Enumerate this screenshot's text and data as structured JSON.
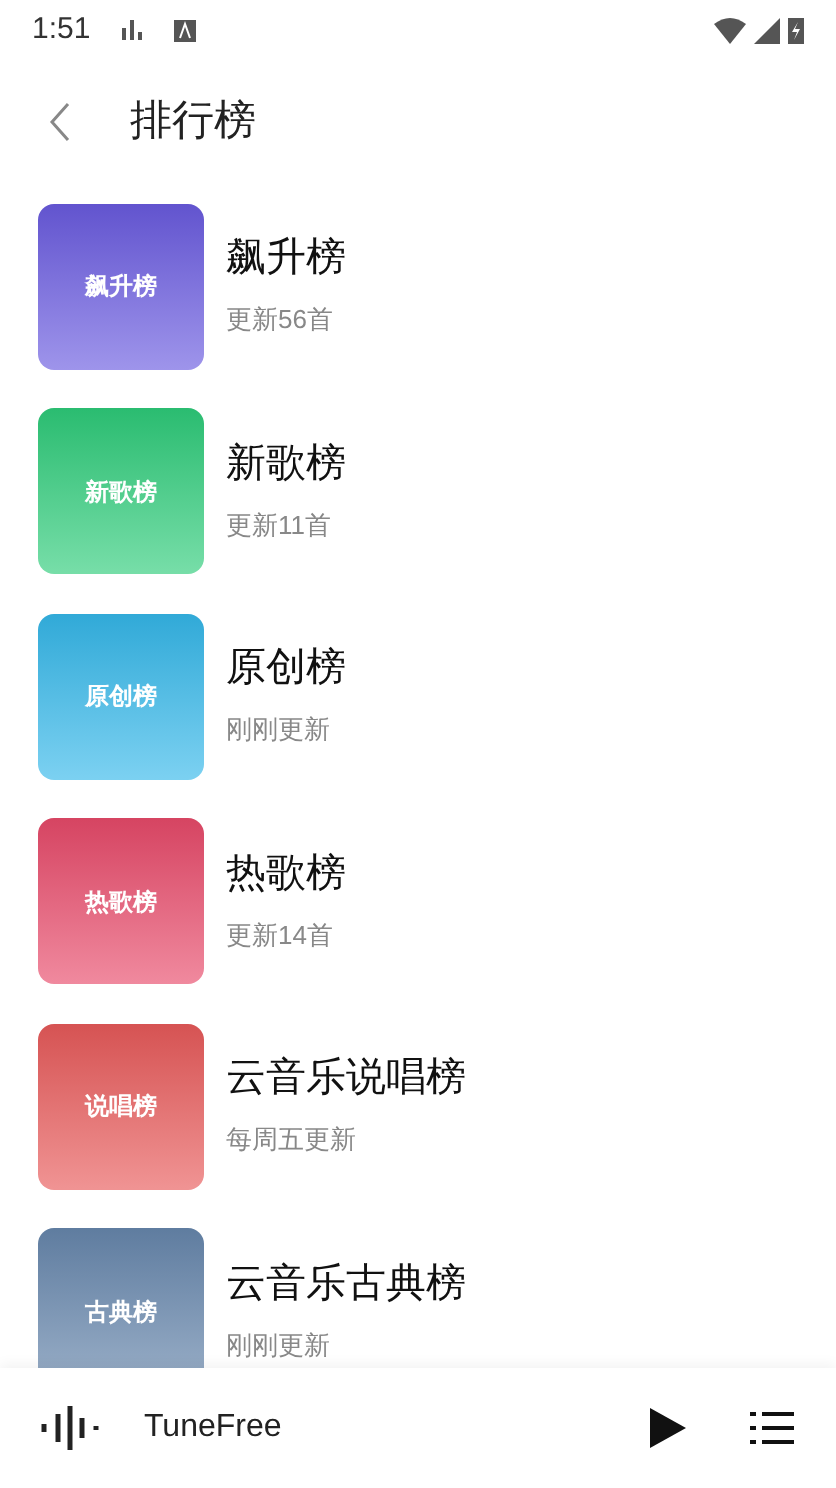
{
  "status_bar": {
    "time": "1:51"
  },
  "header": {
    "title": "排行榜"
  },
  "charts": [
    {
      "cover_label": "飙升榜",
      "name": "飙升榜",
      "update": "更新56首",
      "color": "#6a5be0"
    },
    {
      "cover_label": "新歌榜",
      "name": "新歌榜",
      "update": "更新11首",
      "color": "#2ecc7a"
    },
    {
      "cover_label": "原创榜",
      "name": "原创榜",
      "update": "刚刚更新",
      "color": "#35b8ea"
    },
    {
      "cover_label": "热歌榜",
      "name": "热歌榜",
      "update": "更新14首",
      "color": "#e84a6a"
    },
    {
      "cover_label": "说唱榜",
      "name": "云音乐说唱榜",
      "update": "每周五更新",
      "color": "#e85a5a"
    },
    {
      "cover_label": "古典榜",
      "name": "云音乐古典榜",
      "update": "刚刚更新",
      "color": "#6787ad"
    }
  ],
  "player": {
    "title": "TuneFree"
  }
}
